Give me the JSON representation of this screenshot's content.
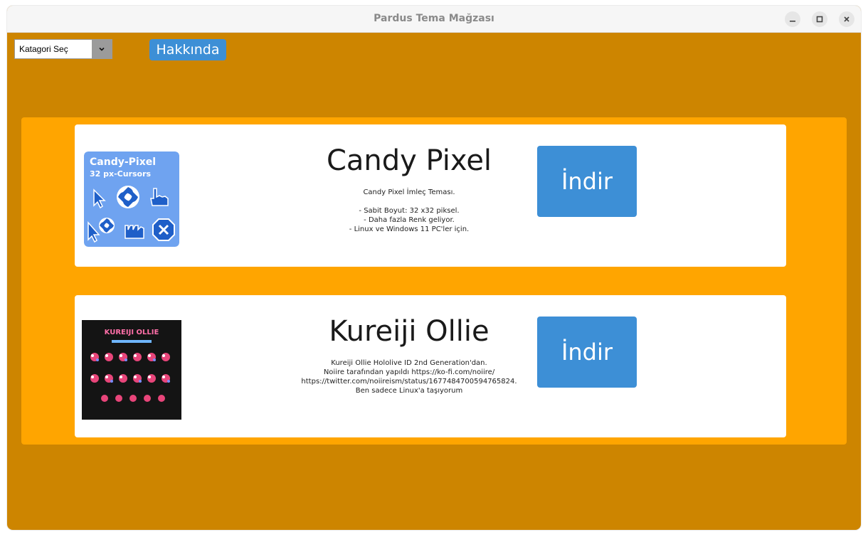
{
  "window": {
    "title": "Pardus Tema Mağzası"
  },
  "toolbar": {
    "category_select_value": "Katagori Seç",
    "about_label": "Hakkında"
  },
  "themes": [
    {
      "name": "Candy Pixel",
      "description": "Candy Pixel İmleç Teması.\n\n- Sabit Boyut: 32 x32 piksel.\n- Daha fazla Renk geliyor.\n- Linux ve Windows 11 PC'ler için.",
      "download_label": "İndir",
      "thumbnail": {
        "title": "Candy-Pixel",
        "subtitle": "32 px-Cursors",
        "bg_color": "#6fa3f0"
      }
    },
    {
      "name": "Kureiji Ollie",
      "description": "Kureiji Ollie Hololive ID 2nd Generation'dan.\nNoiire tarafından yapıldı https://ko-fi.com/noiire/\nhttps://twitter.com/noiireism/status/1677484700594765824.\nBen sadece Linux'a taşıyorum",
      "download_label": "İndir",
      "thumbnail": {
        "title": "KUREIJI OLLIE",
        "bg_color": "#141414"
      }
    }
  ],
  "colors": {
    "window_bg": "#cd8500",
    "panel_bg": "#ffa500",
    "accent": "#3d8fd6"
  }
}
